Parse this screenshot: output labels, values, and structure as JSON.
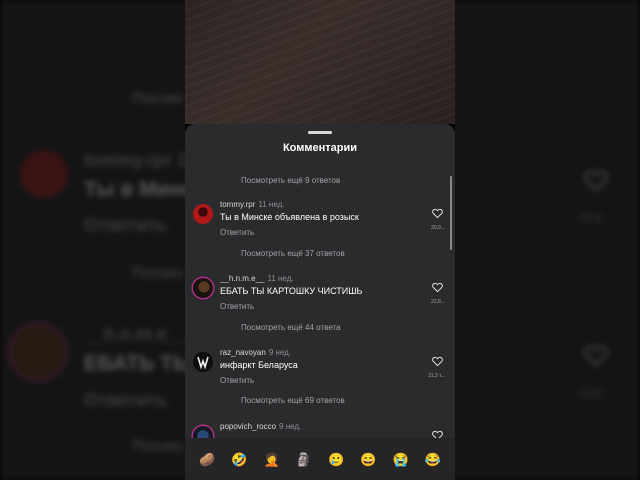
{
  "sheet": {
    "title": "Комментарии"
  },
  "comments": [
    {
      "view_more": "Посмотреть ещё 9 ответов"
    },
    {
      "username": "tommy.rpr",
      "time": "11 нед.",
      "text": "Ты в Минске объявлена в розыск",
      "reply": "Ответить",
      "likes": "20,9...",
      "view_more": "Посмотреть ещё 37 ответов"
    },
    {
      "username": "__h.n.m.e__",
      "time": "11 нед.",
      "text": "ЕБАТЬ ТЫ КАРТОШКУ ЧИСТИШЬ",
      "reply": "Ответить",
      "likes": "22,8...",
      "view_more": "Посмотреть ещё 44 ответа"
    },
    {
      "username": "raz_navoyan",
      "time": "9 нед.",
      "text": "инфаркт Беларуса",
      "reply": "Ответить",
      "likes": "31,3 т...",
      "view_more": "Посмотреть ещё 69 ответов"
    },
    {
      "username": "popovich_rocco",
      "time": "9 нед."
    }
  ],
  "emoji_bar": [
    "🥔",
    "🤣",
    "🤦",
    "🗿",
    "🥲",
    "😄",
    "😭",
    "😂"
  ],
  "background": {
    "lines": [
      "Посмо",
      "tommy.rpr  11",
      "Ты в Минск",
      "Ответить",
      "Посмо",
      "__h.n.m.e__",
      "ЕБАТЬ ТЫ",
      "Ответить",
      "Посмо"
    ],
    "likes_right": [
      "20,9...",
      "22,8..."
    ]
  },
  "colors": {
    "sheet_bg": "#2b2b2e",
    "accent_avatar_ring": "#b0308a"
  }
}
